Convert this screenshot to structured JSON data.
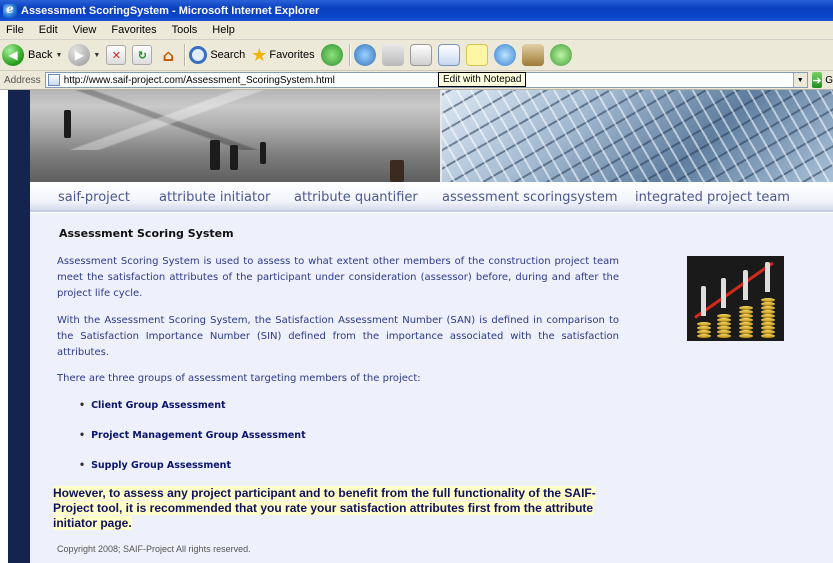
{
  "window": {
    "title": "Assessment ScoringSystem - Microsoft Internet Explorer"
  },
  "menu": [
    "File",
    "Edit",
    "View",
    "Favorites",
    "Tools",
    "Help"
  ],
  "toolbar": {
    "back_label": "Back",
    "search_label": "Search",
    "favorites_label": "Favorites",
    "tooltip": "Edit with Notepad"
  },
  "address": {
    "label": "Address",
    "url": "http://www.saif-project.com/Assessment_ScoringSystem.html",
    "go_label": "G"
  },
  "nav": [
    "saif-project",
    "attribute initiator",
    "attribute quantifier",
    "assessment scoringsystem",
    "integrated project team"
  ],
  "page": {
    "heading": "Assessment Scoring System",
    "p1": "Assessment Scoring System is used to assess to what extent other members of the construction project team meet the satisfaction attributes of the participant under consideration (assessor) before, during and after the project life cycle.",
    "p2": "With the Assessment Scoring System, the Satisfaction Assessment Number (SAN) is defined in comparison to the Satisfaction Importance Number (SIN) defined from the importance associated with the satisfaction attributes.",
    "p3": "There are three groups of assessment targeting members of the project:",
    "bullets": [
      "Client Group Assessment",
      "Project Management Group Assessment",
      "Supply Group Assessment"
    ],
    "note": "However, to assess any project participant and  to benefit from the full functionality of the SAIF-Project tool, it is recommended that you rate your satisfaction attributes first from the attribute initiator page.",
    "copyright": "Copyright 2008; SAIF-Project  All rights reserved."
  },
  "colors": {
    "nav_text": "#4a5890",
    "body_text": "#2d3a8c",
    "content_bg": "#eef0fb",
    "sidebar": "#15234f",
    "note_highlight": "#ffffc8"
  }
}
